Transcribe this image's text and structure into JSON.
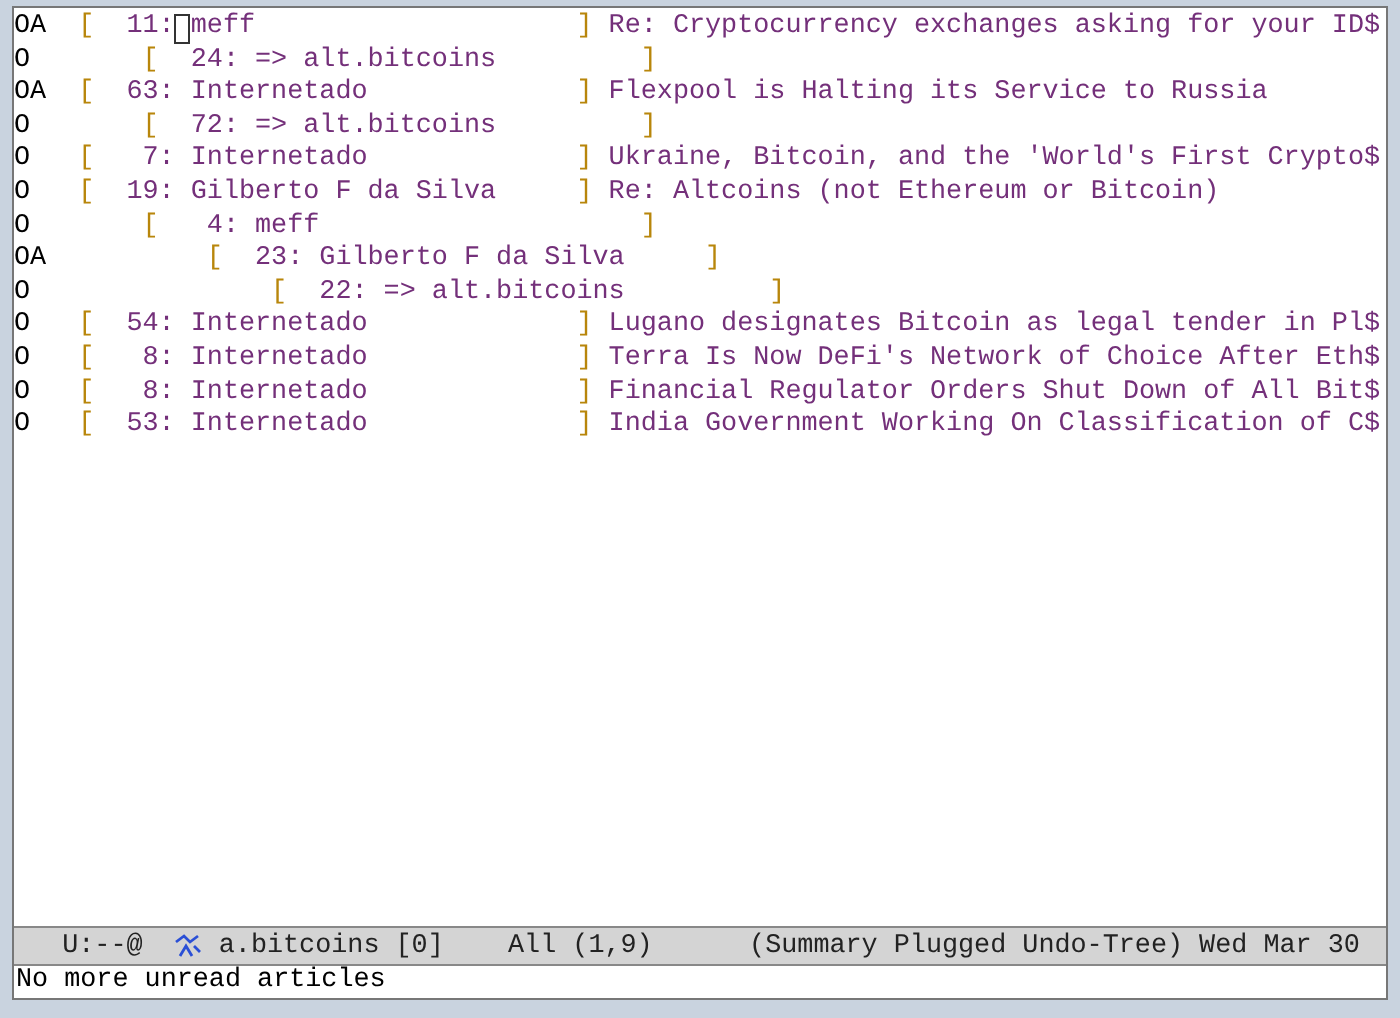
{
  "summary": {
    "threads": [
      {
        "mark": "OA",
        "open": "[",
        "number": "11:",
        "author": "meff",
        "close": "]",
        "subject": "Re: Cryptocurrency exchanges asking for your ID$",
        "cursor": true,
        "children": [
          {
            "mark": "O",
            "open": "[",
            "number": "24:",
            "author": "=> alt.bitcoins",
            "close": "]",
            "cursor": false
          }
        ]
      },
      {
        "mark": "OA",
        "open": "[",
        "number": "63:",
        "author": "Internetado",
        "close": "]",
        "subject": "Flexpool is Halting its Service to Russia",
        "cursor": false,
        "children": [
          {
            "mark": "O",
            "open": "[",
            "number": "72:",
            "author": "=> alt.bitcoins",
            "close": "]",
            "cursor": false
          }
        ]
      },
      {
        "mark": "O",
        "open": "[",
        "number": "7:",
        "author": "Internetado",
        "close": "]",
        "subject": "Ukraine, Bitcoin, and the 'World's First Crypto$",
        "cursor": false
      },
      {
        "mark": "O",
        "open": "[",
        "number": "19:",
        "author": "Gilberto F da Silva",
        "close": "]",
        "subject": "Re: Altcoins (not Ethereum or Bitcoin)",
        "cursor": false,
        "children": [
          {
            "mark": "O",
            "open": "[",
            "number": "4:",
            "author": "meff",
            "close": "]",
            "cursor": false,
            "children": [
              {
                "mark": "OA",
                "open": "[",
                "number": "23:",
                "author": "Gilberto F da Silva",
                "close": "]",
                "cursor": false,
                "children": [
                  {
                    "mark": "O",
                    "open": "[",
                    "number": "22:",
                    "author": "=> alt.bitcoins",
                    "close": "]",
                    "cursor": false
                  }
                ]
              }
            ]
          }
        ]
      },
      {
        "mark": "O",
        "open": "[",
        "number": "54:",
        "author": "Internetado",
        "close": "]",
        "subject": "Lugano designates Bitcoin as legal tender in Pl$",
        "cursor": false
      },
      {
        "mark": "O",
        "open": "[",
        "number": "8:",
        "author": "Internetado",
        "close": "]",
        "subject": "Terra Is Now DeFi's Network of Choice After Eth$",
        "cursor": false
      },
      {
        "mark": "O",
        "open": "[",
        "number": "8:",
        "author": "Internetado",
        "close": "]",
        "subject": "Financial Regulator Orders Shut Down of All Bit$",
        "cursor": false
      },
      {
        "mark": "O",
        "open": "[",
        "number": "53:",
        "author": "Internetado",
        "close": "]",
        "subject": "India Government Working On Classification of C$",
        "cursor": false
      }
    ]
  },
  "mode_line": {
    "state": "U:--@",
    "buffer": "a.bitcoins [0]",
    "position": "All (1,9)",
    "modes": "(Summary Plugged Undo-Tree) Wed Mar 30"
  },
  "echo_area": "No more unread articles"
}
